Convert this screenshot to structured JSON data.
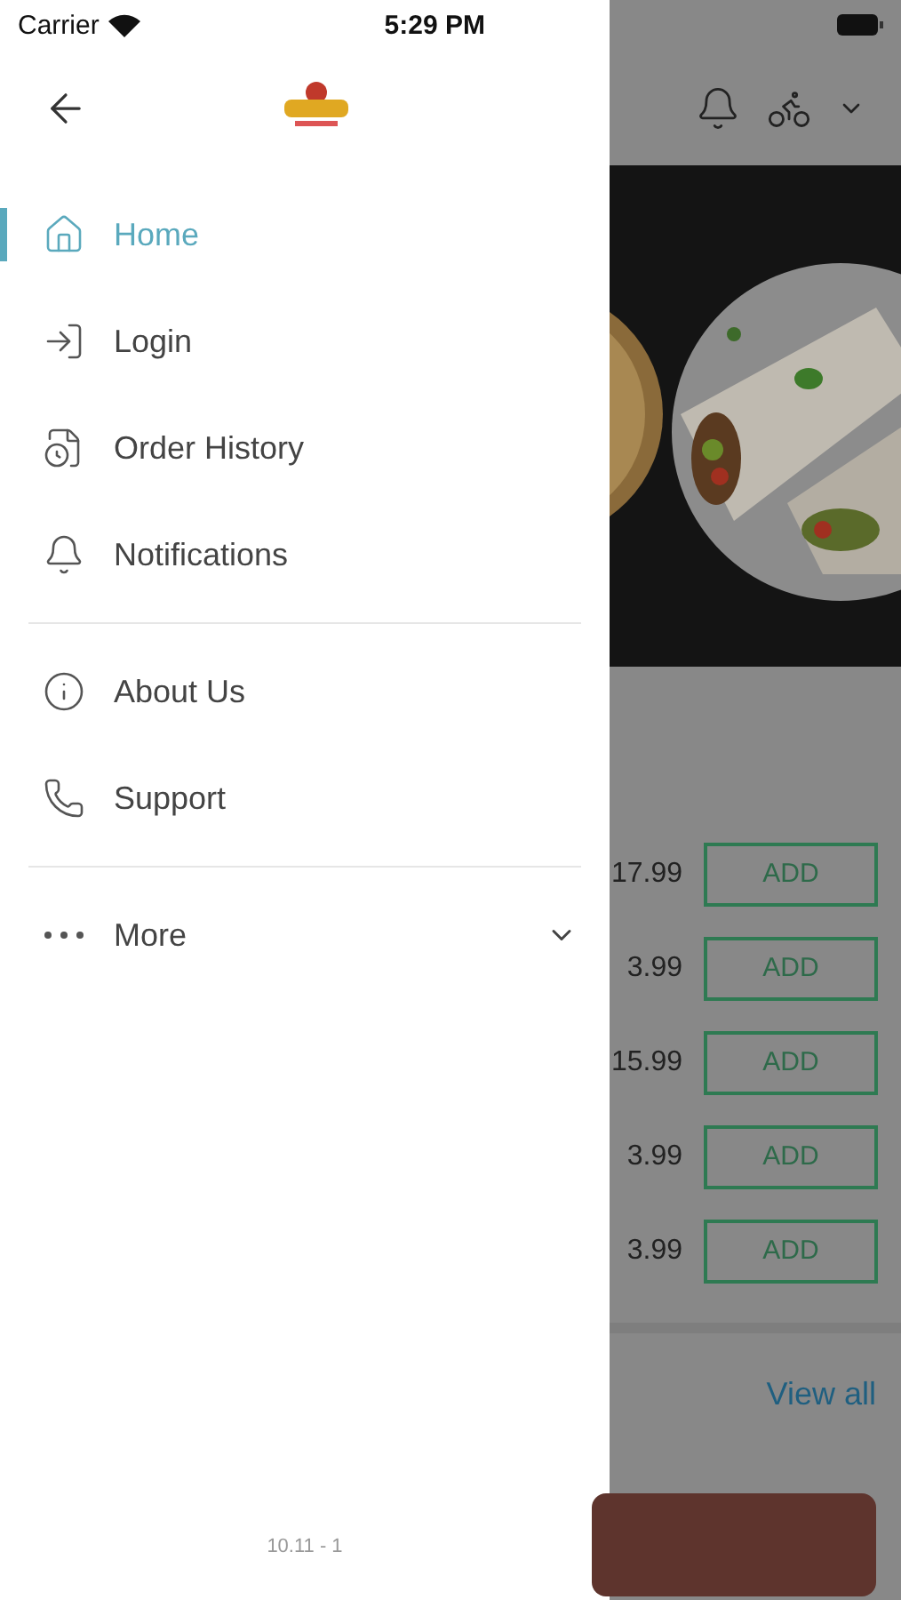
{
  "status_bar": {
    "carrier": "Carrier",
    "time": "5:29 PM"
  },
  "drawer": {
    "sections": [
      {
        "items": [
          {
            "label": "Home",
            "selected": true
          },
          {
            "label": "Login",
            "selected": false
          },
          {
            "label": "Order History",
            "selected": false
          },
          {
            "label": "Notifications",
            "selected": false
          }
        ]
      },
      {
        "items": [
          {
            "label": "About Us",
            "selected": false
          },
          {
            "label": "Support",
            "selected": false
          }
        ]
      },
      {
        "items": [
          {
            "label": "More",
            "selected": false,
            "expanded": false
          }
        ]
      }
    ],
    "version": "10.11 - 1"
  },
  "background": {
    "products": [
      {
        "price": "17.99",
        "button": "ADD"
      },
      {
        "price": "3.99",
        "button": "ADD"
      },
      {
        "price": "15.99",
        "button": "ADD"
      },
      {
        "price": "3.99",
        "button": "ADD"
      },
      {
        "price": "3.99",
        "button": "ADD"
      }
    ],
    "view_all": "View all"
  }
}
